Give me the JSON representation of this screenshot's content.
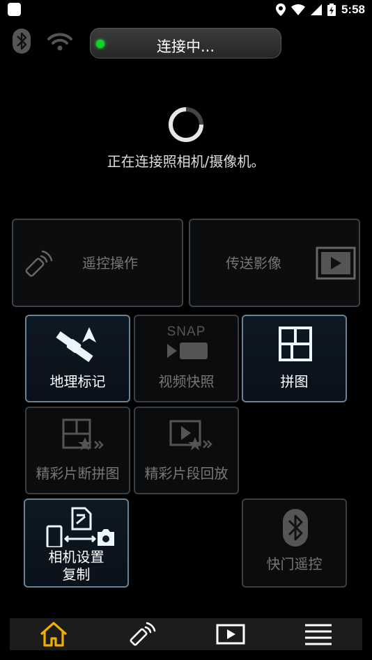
{
  "status_bar": {
    "time": "5:58"
  },
  "connection": {
    "status_text": "连接中...",
    "status_color": "#12d02a"
  },
  "message": "正在连接照相机/摄像机。",
  "tiles": {
    "remote": "遥控操作",
    "transfer": "传送影像",
    "geotag": "地理标记",
    "snap_movie": "视频快照",
    "snap_icon_text": "SNAP",
    "collage": "拼图",
    "highlight_collage": "精彩片断拼图",
    "highlight_playback": "精彩片段回放",
    "copy_settings_line1": "相机设置",
    "copy_settings_line2": "复制",
    "bt_shutter": "快门遥控"
  },
  "nav": [
    "home-icon",
    "remote-icon",
    "playback-icon",
    "menu-icon"
  ],
  "colors": {
    "accent_home": "#f0b000",
    "tile_active_border": "#6a8296"
  }
}
